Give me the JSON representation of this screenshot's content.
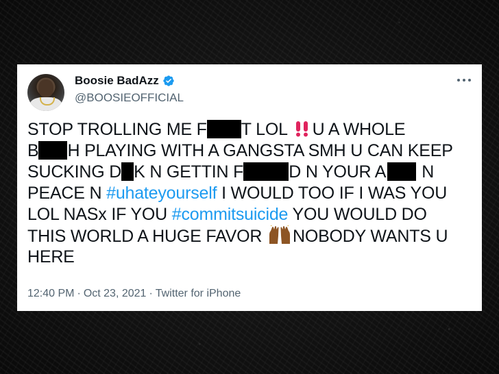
{
  "tweet": {
    "display_name": "Boosie BadAzz",
    "handle": "@BOOSIEOFFICIAL",
    "colors": {
      "text": "#0f1419",
      "hashtag": "#1d9bf0",
      "muted": "#536471",
      "verified": "#1d9bf0"
    },
    "icons": [
      "verified-badge-icon",
      "more-options-icon",
      "double-exclamation-icon",
      "raising-hands-icon"
    ],
    "body": {
      "l1_a": "STOP TROLLING ME F",
      "l1_b": "T LOL",
      "l1_c": "U A WHOLE",
      "l2_a": "B",
      "l2_b": "H PLAYING WITH A GANGSTA SMH U CAN KEEP",
      "l3_a": "SUCKING D",
      "l3_b": "K N GETTIN F",
      "l3_c": "D N YOUR A",
      "l3_d": "N",
      "l4_a": "PEACE N",
      "l4_hashtag": "#uhateyourself",
      "l4_b": "I WOULD TOO IF I WAS YOU",
      "l5_a": "LOL NASx IF YOU",
      "l5_hashtag": "#commitsuicide",
      "l5_b": "YOU WOULD DO",
      "l6_a": "THIS WORLD A HUGE FAVOR",
      "l6_b": "NOBODY WANTS U",
      "l7_a": "HERE"
    },
    "footer": {
      "time": "12:40 PM",
      "separator": "·",
      "date": "Oct 23, 2021",
      "source": "Twitter for iPhone"
    }
  }
}
